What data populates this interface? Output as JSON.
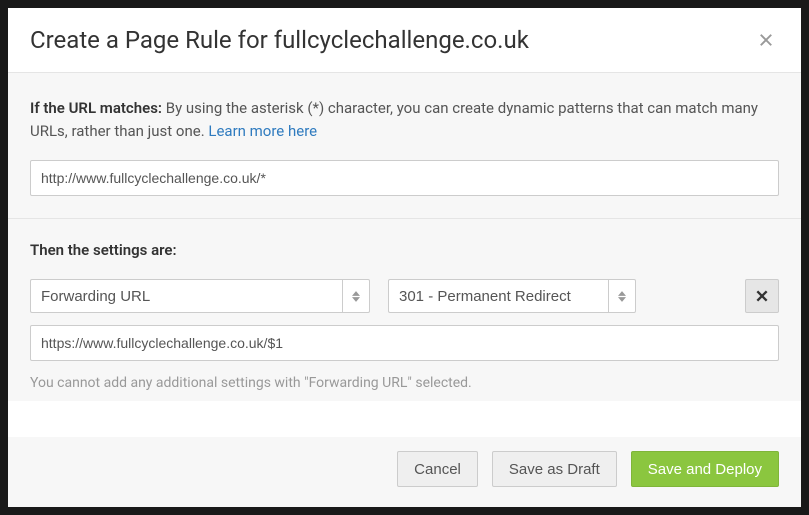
{
  "header": {
    "title": "Create a Page Rule for fullcyclechallenge.co.uk"
  },
  "intro": {
    "strong": "If the URL matches:",
    "text": " By using the asterisk (*) character, you can create dynamic patterns that can match many URLs, rather than just one. ",
    "link": "Learn more here"
  },
  "url_input": "http://www.fullcyclechallenge.co.uk/*",
  "settings": {
    "heading": "Then the settings are:",
    "setting_select": "Forwarding URL",
    "redirect_select": "301 - Permanent Redirect",
    "destination": "https://www.fullcyclechallenge.co.uk/$1",
    "note": "You cannot add any additional settings with \"Forwarding URL\" selected."
  },
  "footer": {
    "cancel": "Cancel",
    "draft": "Save as Draft",
    "deploy": "Save and Deploy"
  }
}
